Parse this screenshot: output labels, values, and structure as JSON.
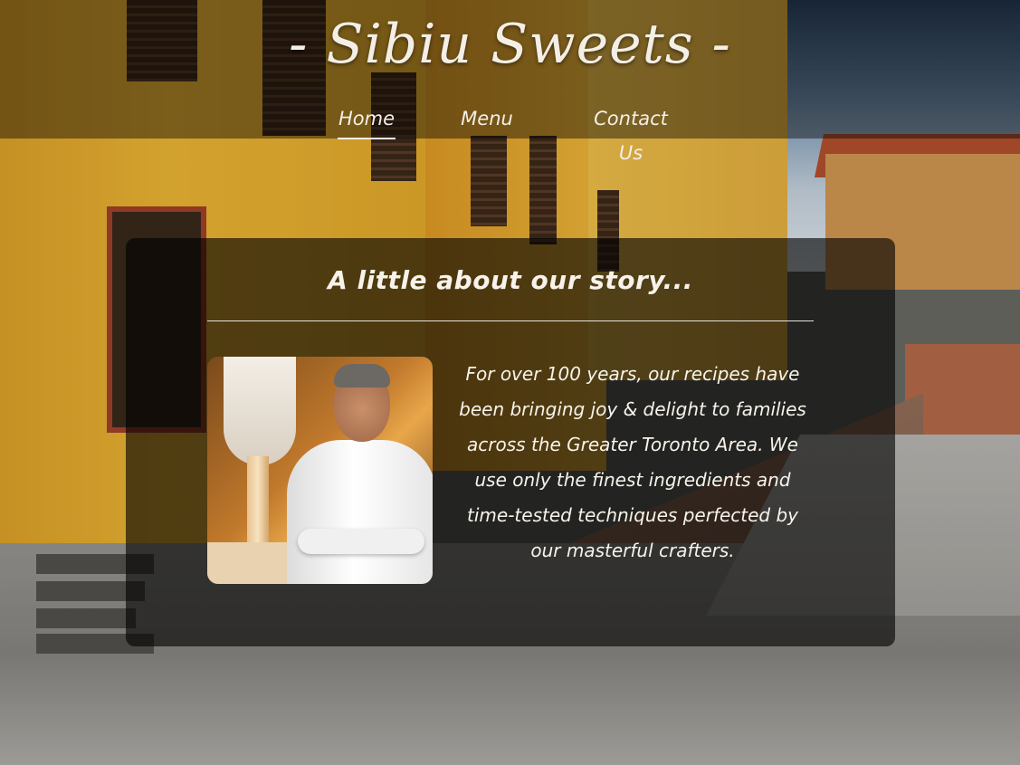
{
  "header": {
    "logo_text": "- Sibiu Sweets -",
    "nav": [
      {
        "label": "Home",
        "active": true
      },
      {
        "label": "Menu",
        "active": false
      },
      {
        "label": "Contact Us",
        "active": false
      }
    ]
  },
  "main": {
    "heading": "A little about our story...",
    "photo_icon": "chef-photo",
    "story": "For over 100 years, our recipes have been bringing joy & delight to families across the Greater Toronto Area. We use only the finest ingredients and time-tested techniques perfected by our masterful crafters."
  },
  "colors": {
    "text": "#f4efe6",
    "overlay": "rgba(0,0,0,0.62)",
    "header_overlay": "rgba(0,0,0,0.42)"
  }
}
